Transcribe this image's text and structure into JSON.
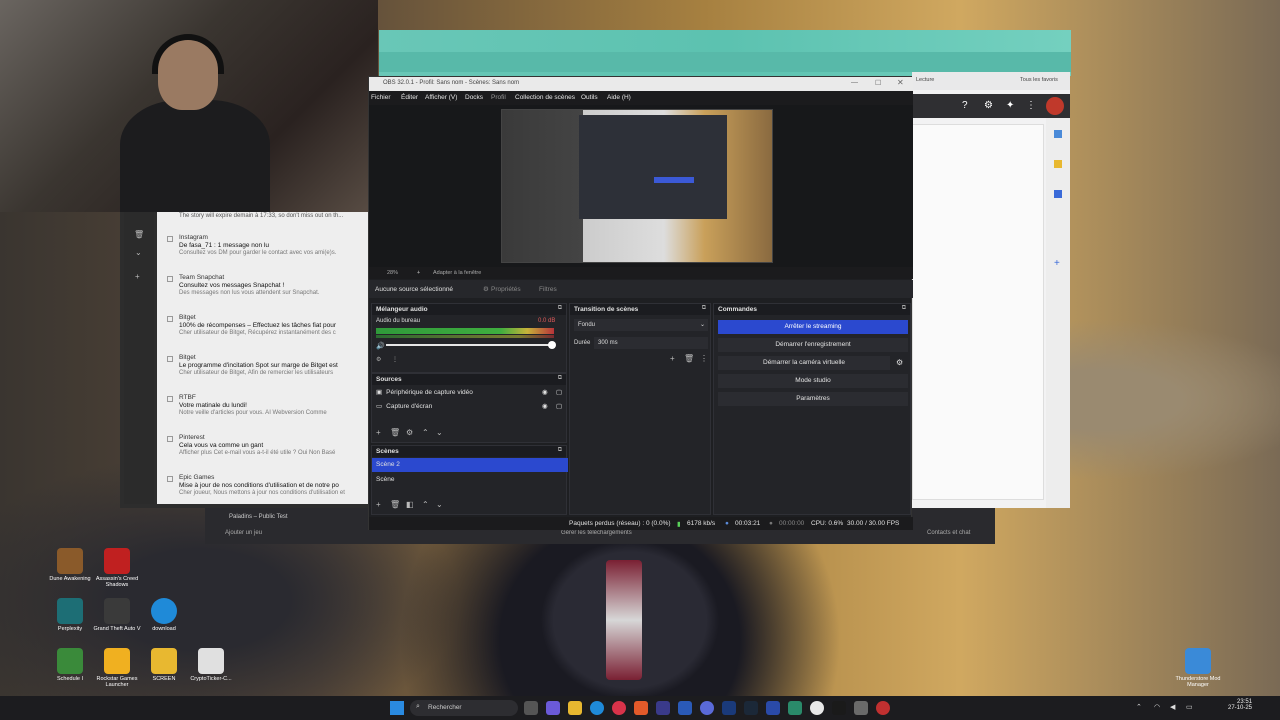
{
  "obs": {
    "title": "OBS 32.0.1 - Profil: Sans nom - Scènes: Sans nom",
    "menu": [
      "Fichier",
      "Éditer",
      "Afficher (V)",
      "Docks",
      "Profil",
      "Collection de scènes",
      "Outils",
      "Aide (H)"
    ],
    "zoom": "28%",
    "fit_label": "Adapter à la fenêtre",
    "no_source": "Aucune source sélectionné",
    "properties": "Propriétés",
    "filters": "Filtres",
    "mixer": {
      "title": "Mélangeur audio",
      "channel": "Audio du bureau",
      "db": "0.0 dB",
      "ticks": [
        "-60",
        "-55",
        "-50",
        "-45",
        "-40",
        "-35",
        "-30",
        "-25",
        "-20",
        "-15",
        "-10",
        "-5",
        "0"
      ]
    },
    "transition": {
      "title": "Transition de scènes",
      "value": "Fondu",
      "duration_label": "Durée",
      "duration": "300 ms"
    },
    "commands": {
      "title": "Commandes",
      "buttons": [
        "Arrêter le streaming",
        "Démarrer l'enregistrement",
        "Démarrer la caméra virtuelle",
        "Mode studio",
        "Paramètres"
      ]
    },
    "sources": {
      "title": "Sources",
      "items": [
        "Périphérique de capture vidéo",
        "Capture d'écran"
      ]
    },
    "scenes": {
      "title": "Scènes",
      "items": [
        "Scène 2",
        "Scène"
      ],
      "selected": "Scène 2"
    },
    "status": {
      "dropped": "Paquets perdus (réseau) : 0 (0.0%)",
      "bitrate": "6178 kb/s",
      "stream_time": "00:03:21",
      "rec_time": "00:00:00",
      "cpu": "CPU: 0.6%",
      "fps": "30.00 / 30.00 FPS"
    }
  },
  "notifications": {
    "top_line": "The story will expire demain à 17:33, so don't miss out on th...",
    "items": [
      {
        "source": "Instagram",
        "title": "De fasa_71 : 1 message non lu",
        "body": "Consultez vos DM pour garder le contact avec vos ami(e)s."
      },
      {
        "source": "Team Snapchat",
        "title": "Consultez vos messages Snapchat !",
        "body": "Des messages non lus vous attendent sur Snapchat."
      },
      {
        "source": "Bitget",
        "title": "100% de récompenses – Effectuez les tâches fiat pour",
        "body": "Cher utilisateur de Bitget, Récupérez instantanément des c"
      },
      {
        "source": "Bitget",
        "title": "Le programme d'incitation Spot sur marge de Bitget est",
        "body": "Cher utilisateur de Bitget, Afin de remercier les utilisateurs"
      },
      {
        "source": "RTBF",
        "title": "Votre matinale du lundi!",
        "body": "Notre veille d'articles pour vous. AI Webversion Comme"
      },
      {
        "source": "Pinterest",
        "title": "Cela vous va comme un gant",
        "body": "Afficher plus Cet e-mail vous a-t-il été utile ? Oui Non Basé"
      },
      {
        "source": "Epic Games",
        "title": "Mise à jour de nos conditions d'utilisation et de notre po",
        "body": "Cher joueur, Nous mettons à jour nos conditions d'utilisation et"
      }
    ]
  },
  "launcher": {
    "game": "Paladins – Public Test",
    "add_game": "Ajouter un jeu",
    "downloads": "Gérer les téléchargements",
    "friends": "Contacts et chat"
  },
  "desktop_icons": [
    {
      "label": "Dune Awakening",
      "color": "#8a5a2a"
    },
    {
      "label": "Assassin's Creed Shadows",
      "color": "#c02020"
    },
    {
      "label": "Perplexity",
      "color": "#1d6e75"
    },
    {
      "label": "Grand Theft Auto V",
      "color": "#3a3a3a"
    },
    {
      "label": "download",
      "color": "#1f8ad8"
    },
    {
      "label": "Schedule I",
      "color": "#3a8a3a"
    },
    {
      "label": "Rockstar Games Launcher",
      "color": "#f0b020"
    },
    {
      "label": "SCREEN",
      "color": "#e8b830"
    },
    {
      "label": "CryptoTicker-C...",
      "color": "#e0e0e0"
    },
    {
      "label": "Thunderstore Mod Manager",
      "color": "#3a8ad8"
    }
  ],
  "taskbar": {
    "search": "Rechercher",
    "time": "23:51",
    "date": "27-10-25"
  },
  "browser": {
    "bookmark1": "Lecture",
    "bookmark2": "Tous les favoris"
  }
}
